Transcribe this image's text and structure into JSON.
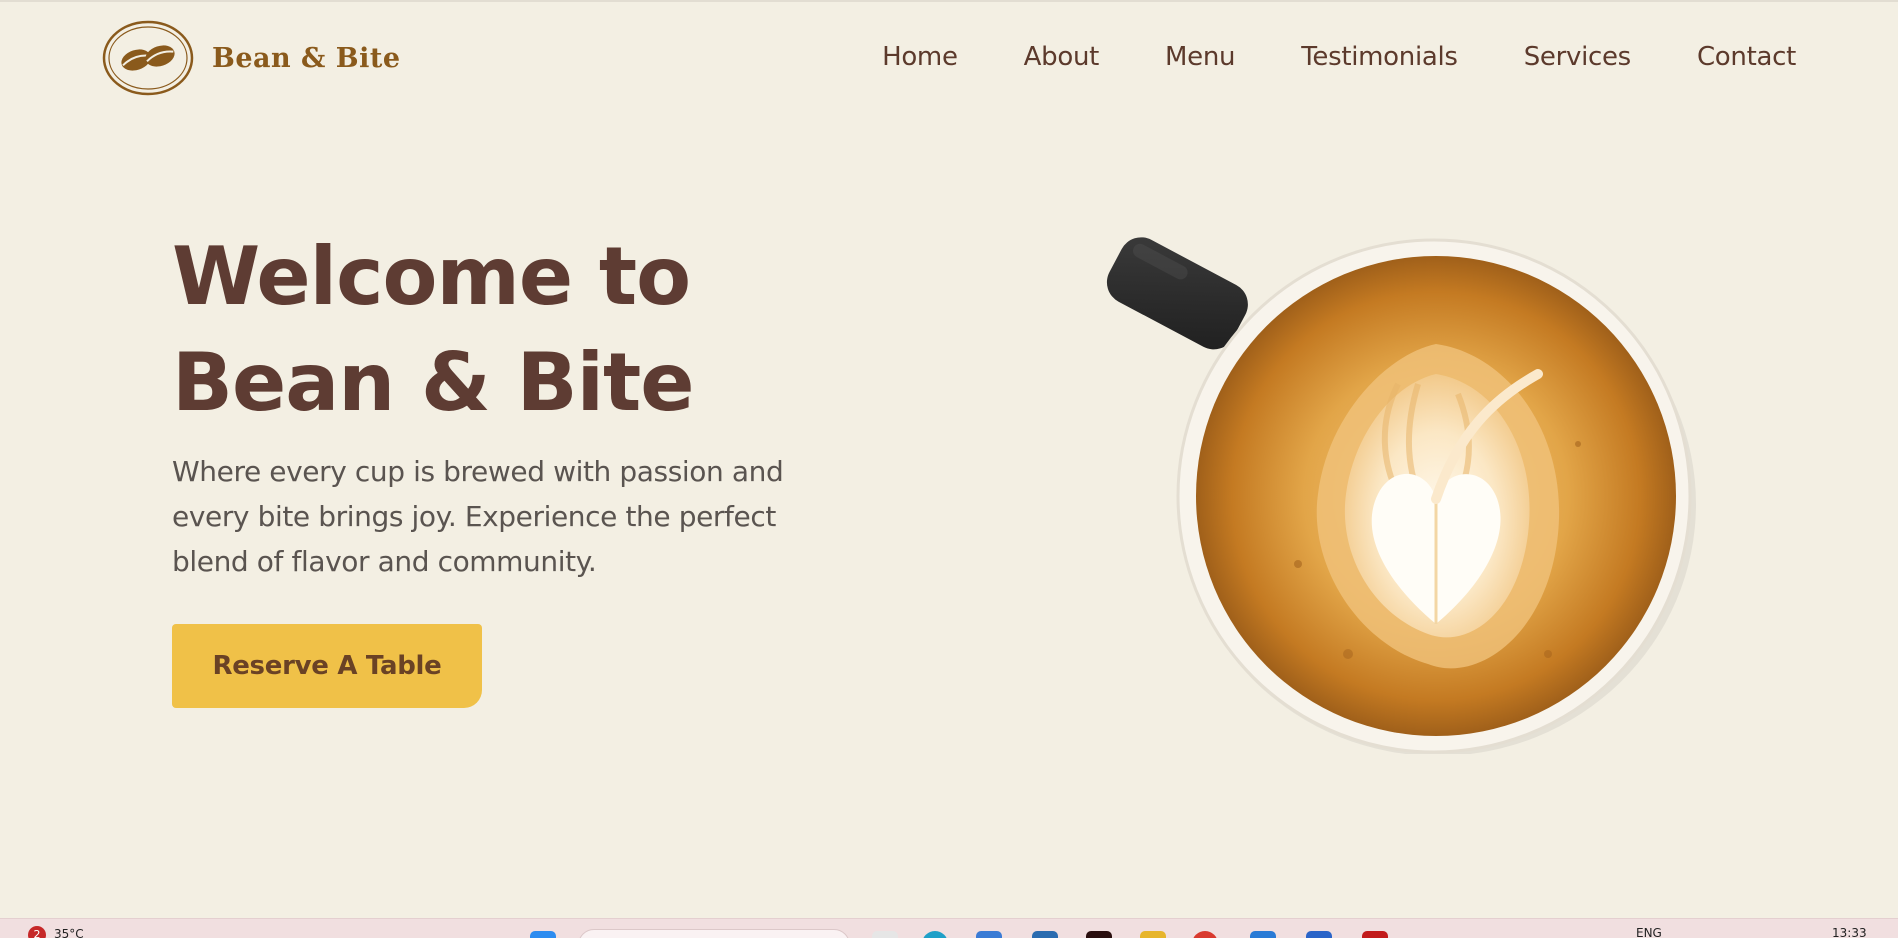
{
  "header": {
    "brand_name": "Bean & Bite",
    "nav": [
      "Home",
      "About",
      "Menu",
      "Testimonials",
      "Services",
      "Contact"
    ]
  },
  "hero": {
    "title_line1": "Welcome to",
    "title_line2": "Bean & Bite",
    "description": "Where every cup is brewed with passion and every bite brings joy. Experience the perfect blend of flavor and community.",
    "cta_label": "Reserve A Table"
  },
  "taskbar": {
    "notification_count": "2",
    "temperature": "35°C",
    "language": "ENG",
    "time": "13:33",
    "apps": [
      "windows-start-icon",
      "search-box",
      "file-icon",
      "edge-icon",
      "copilot-icon",
      "store-icon",
      "app-icon",
      "folder-icon",
      "chrome-icon",
      "vscode-icon",
      "word-icon",
      "acrobat-icon"
    ]
  },
  "colors": {
    "background": "#f3efe3",
    "heading": "#5e3c33",
    "nav_text": "#5c3a2c",
    "brand": "#8a5a1c",
    "cta_bg": "#f0c148",
    "cta_text": "#6a4225",
    "body_text": "#5a5450"
  }
}
